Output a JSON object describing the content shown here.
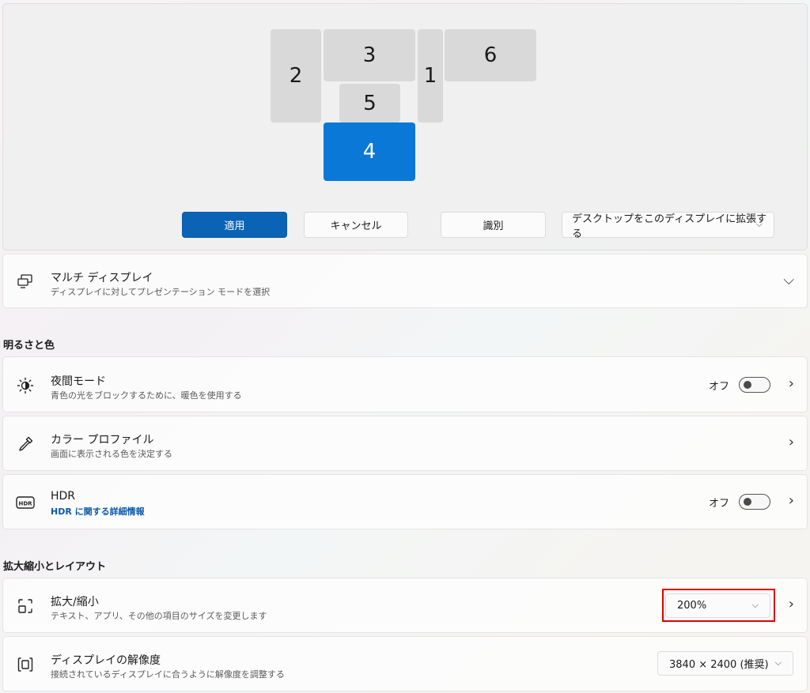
{
  "monitors": [
    {
      "id": "2",
      "active": false
    },
    {
      "id": "3",
      "active": false
    },
    {
      "id": "5",
      "active": false
    },
    {
      "id": "1",
      "active": false
    },
    {
      "id": "6",
      "active": false
    },
    {
      "id": "4",
      "active": true
    }
  ],
  "arrangement_buttons": {
    "apply": "適用",
    "cancel": "キャンセル",
    "identify": "識別",
    "mode_select": "デスクトップをこのディスプレイに拡張する"
  },
  "multi_display": {
    "title": "マルチ ディスプレイ",
    "subtitle": "ディスプレイに対してプレゼンテーション モードを選択"
  },
  "sections": {
    "brightness_color": "明るさと色",
    "scale_layout": "拡大縮小とレイアウト"
  },
  "night_mode": {
    "title": "夜間モード",
    "subtitle": "青色の光をブロックするために、暖色を使用する",
    "state": "オフ"
  },
  "color_profile": {
    "title": "カラー プロファイル",
    "subtitle": "画面に表示される色を決定する"
  },
  "hdr": {
    "title": "HDR",
    "link": "HDR に関する詳細情報",
    "state": "オフ",
    "icon_text": "HDR"
  },
  "scale": {
    "title": "拡大/縮小",
    "subtitle": "テキスト、アプリ、その他の項目のサイズを変更します",
    "value": "200%"
  },
  "resolution": {
    "title": "ディスプレイの解像度",
    "subtitle": "接続されているディスプレイに合うように解像度を調整する",
    "value": "3840 × 2400 (推奨)"
  },
  "colors": {
    "accent": "#0a78d6",
    "apply_button": "#0b63b6",
    "highlight": "#e00000",
    "link": "#0a59a8"
  }
}
